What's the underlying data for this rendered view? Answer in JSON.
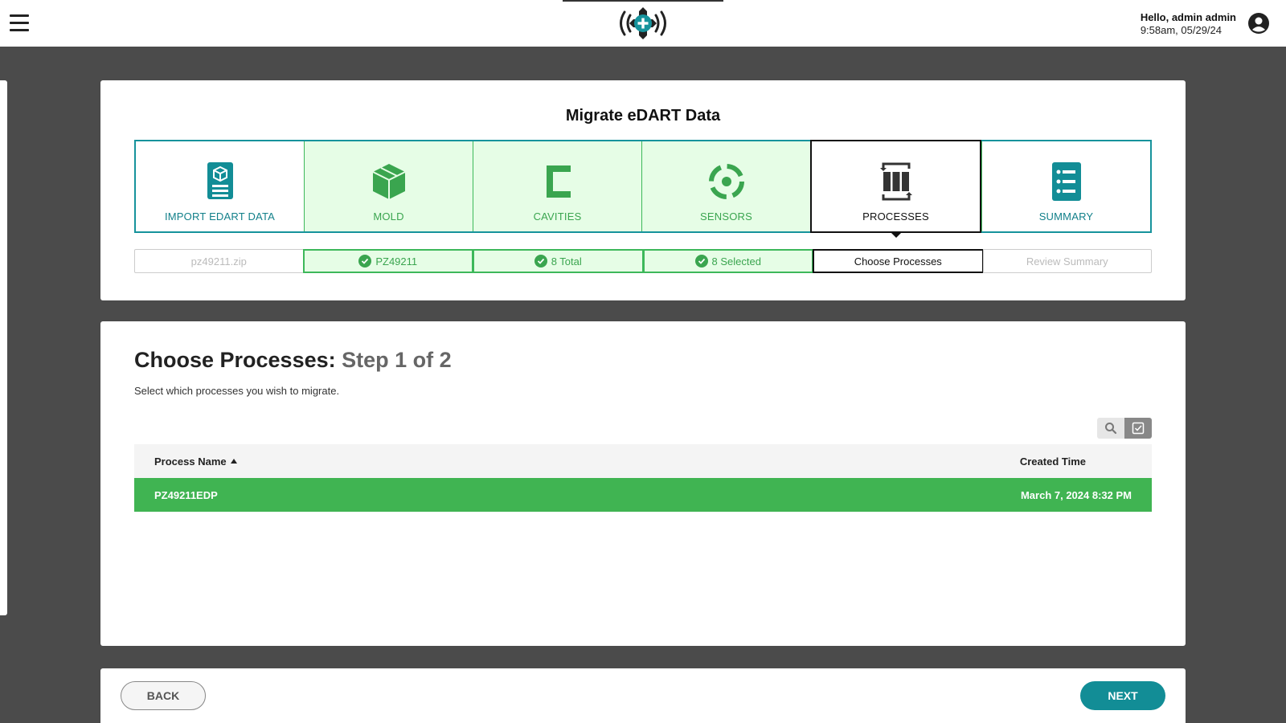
{
  "header": {
    "menu_icon": "hamburger-icon",
    "logo_icon": "signal-plus-logo",
    "greeting": "Hello, admin admin",
    "datetime": "9:58am, 05/29/24",
    "account_icon": "user-circle-icon"
  },
  "wizard": {
    "title": "Migrate eDART Data",
    "steps": [
      {
        "label": "IMPORT EDART DATA",
        "icon": "package-document-icon",
        "state": "teal"
      },
      {
        "label": "MOLD",
        "icon": "cube-icon",
        "state": "done"
      },
      {
        "label": "CAVITIES",
        "icon": "cavity-bracket-icon",
        "state": "done"
      },
      {
        "label": "SENSORS",
        "icon": "target-sensor-icon",
        "state": "done"
      },
      {
        "label": "PROCESSES",
        "icon": "process-cycle-icon",
        "state": "active"
      },
      {
        "label": "SUMMARY",
        "icon": "list-summary-icon",
        "state": "teal"
      }
    ],
    "substeps": [
      {
        "text": "pz49211.zip",
        "state": "disabled"
      },
      {
        "text": "PZ49211",
        "state": "done"
      },
      {
        "text": "8 Total",
        "state": "done"
      },
      {
        "text": "8 Selected",
        "state": "done"
      },
      {
        "text": "Choose Processes",
        "state": "active"
      },
      {
        "text": "Review Summary",
        "state": "disabled"
      }
    ]
  },
  "processes": {
    "title": "Choose Processes:",
    "step_of": "Step 1 of 2",
    "description": "Select which processes you wish to migrate.",
    "search_icon": "search-icon",
    "select_all_icon": "checkbox-icon",
    "columns": {
      "name": "Process Name",
      "created": "Created Time"
    },
    "sort": "ascending",
    "rows": [
      {
        "name": "PZ49211EDP",
        "created": "March 7, 2024 8:32 PM",
        "selected": true
      }
    ]
  },
  "footer": {
    "back_label": "BACK",
    "next_label": "NEXT"
  },
  "colors": {
    "teal": "#128d96",
    "green": "#40b452",
    "done_bg": "#e6fde6",
    "backdrop": "#4b4b4b"
  }
}
